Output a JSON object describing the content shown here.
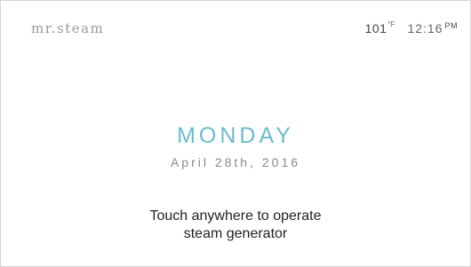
{
  "brand": {
    "name": "mr.steam"
  },
  "status": {
    "temperature": "101",
    "temperature_unit": "°F",
    "time": "12:16",
    "meridiem": "PM"
  },
  "main": {
    "day": "MONDAY",
    "date": "April 28th, 2016",
    "prompt_line1": "Touch anywhere to operate",
    "prompt_line2": "steam generator"
  },
  "colors": {
    "accent": "#6bbccb",
    "brand_text": "#9a9a9a",
    "border": "#d4d4d4"
  }
}
